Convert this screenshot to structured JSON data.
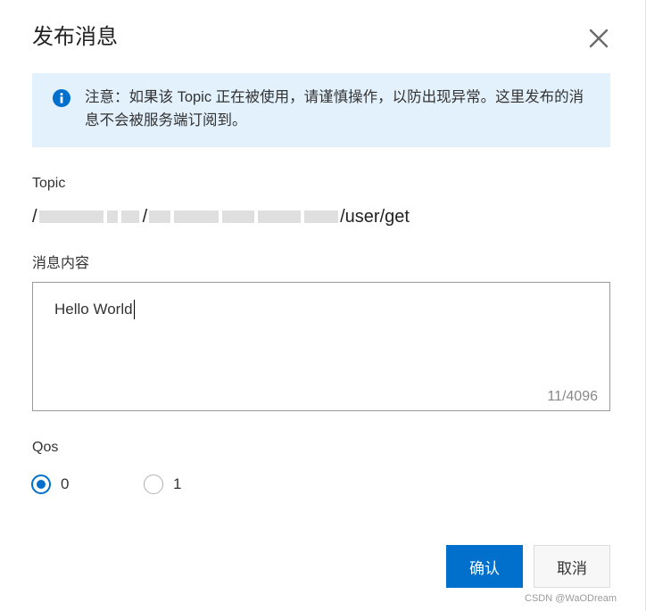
{
  "dialog": {
    "title": "发布消息",
    "close_icon": "close-icon"
  },
  "notice": {
    "icon": "info-icon",
    "text": "注意：如果该 Topic 正在被使用，请谨慎操作，以防出现异常。这里发布的消息不会被服务端订阅到。"
  },
  "form": {
    "topic_label": "Topic",
    "topic_value_suffix": "/user/get",
    "content_label": "消息内容",
    "content_value": "Hello World",
    "char_counter": "11/4096",
    "qos_label": "Qos",
    "qos_options": [
      {
        "label": "0",
        "checked": true
      },
      {
        "label": "1",
        "checked": false
      }
    ]
  },
  "buttons": {
    "confirm_label": "确认",
    "cancel_label": "取消"
  },
  "watermark": "CSDN @WaODream",
  "colors": {
    "primary": "#0070cc",
    "notice_bg": "#e3f1fc"
  }
}
